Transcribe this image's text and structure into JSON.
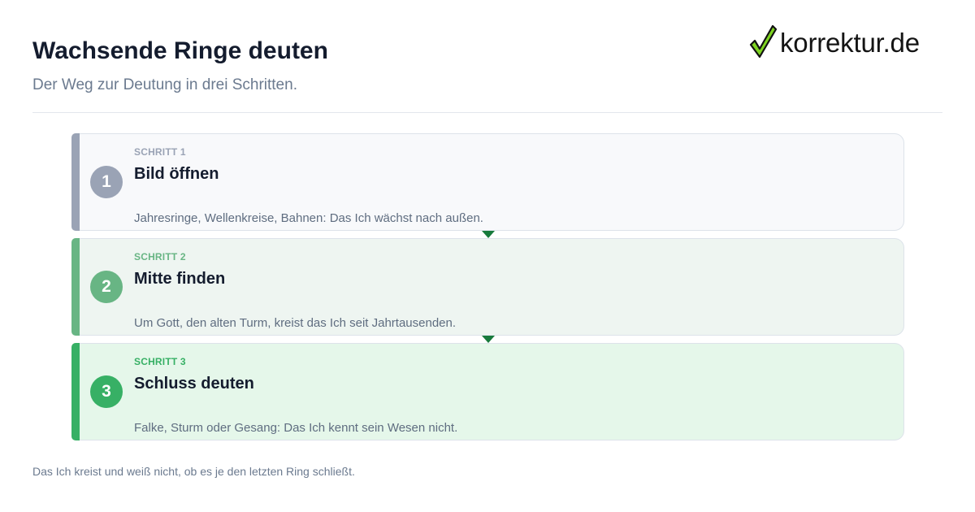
{
  "header": {
    "title": "Wachsende Ringe deuten",
    "subtitle": "Der Weg zur Deutung in drei Schritten."
  },
  "logo": {
    "text": "korrektur.de",
    "icon": "checkmark-icon",
    "check_color": "#7ed321"
  },
  "steps": [
    {
      "kicker": "SCHRITT 1",
      "number": "1",
      "title": "Bild öffnen",
      "description": "Jahresringe, Wellenkreise, Bahnen: Das Ich wächst nach außen.",
      "accent": "#9aa3b5",
      "background": "#f8f9fb"
    },
    {
      "kicker": "SCHRITT 2",
      "number": "2",
      "title": "Mitte finden",
      "description": "Um Gott, den alten Turm, kreist das Ich seit Jahrtausenden.",
      "accent": "#68b584",
      "background": "#eef5f1"
    },
    {
      "kicker": "SCHRITT 3",
      "number": "3",
      "title": "Schluss deuten",
      "description": "Falke, Sturm oder Gesang: Das Ich kennt sein Wesen nicht.",
      "accent": "#37b065",
      "background": "#e5f7ea"
    }
  ],
  "connector_color": "#177a3c",
  "footer": {
    "text": "Das Ich kreist und weiß nicht, ob es je den letzten Ring schließt."
  }
}
